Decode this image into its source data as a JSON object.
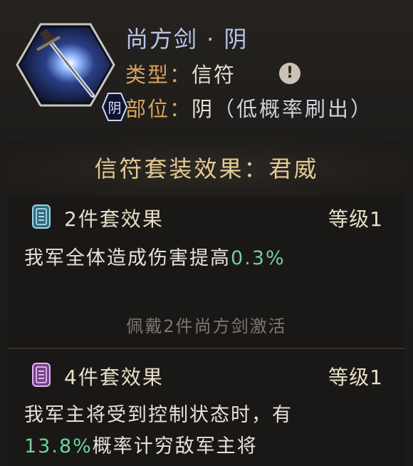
{
  "item": {
    "name": "尚方剑 · 阴",
    "badge": "阴",
    "type_label": "类型：",
    "type_value": "信符",
    "position_label": "部位：",
    "position_value": "阴",
    "position_note": "（低概率刷出）",
    "info_icon": "!"
  },
  "set": {
    "title": "信符套装效果：君威",
    "effects": [
      {
        "name": "2件套效果",
        "level": "等级1",
        "desc_prefix": "我军全体造成伤害提高",
        "value": "0.3%",
        "tag_color": "#5aa6c4"
      },
      {
        "name": "4件套效果",
        "level": "等级1",
        "desc_line1": "我军主将受到控制状态时，有",
        "value": "13.8%",
        "desc_line2_suffix": "概率计穷敌军主将",
        "tag_color": "#b070c8"
      }
    ],
    "activate_hint": "佩戴2件尚方剑激活"
  },
  "colors": {
    "title_blue": "#b8c4ea",
    "label_gold": "#d9a25a",
    "set_gold": "#e5ca94",
    "value_green": "#6ed29a"
  }
}
